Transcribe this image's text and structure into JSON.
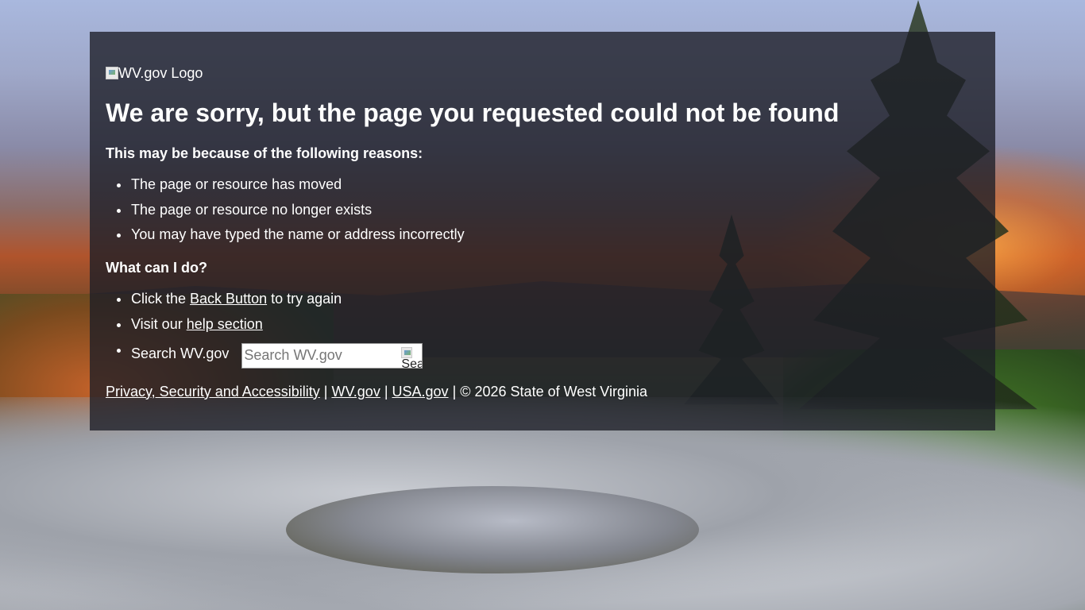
{
  "logo": {
    "alt": "WV.gov Logo"
  },
  "heading": "We are sorry, but the page you requested could not be found",
  "reasons": {
    "title": "This may be because of the following reasons:",
    "items": [
      "The page or resource has moved",
      "The page or resource no longer exists",
      "You may have typed the name or address incorrectly"
    ]
  },
  "actions": {
    "title": "What can I do?",
    "back": {
      "prefix": "Click the ",
      "link": "Back Button",
      "suffix": " to try again"
    },
    "help": {
      "prefix": "Visit our ",
      "link": "help section"
    },
    "search": {
      "label": "Search WV.gov",
      "placeholder": "Search WV.gov",
      "button_alt": "Search"
    }
  },
  "footer": {
    "privacy": "Privacy, Security and Accessibility",
    "sep1": " | ",
    "wvgov": "WV.gov",
    "sep2": " | ",
    "usagov": "USA.gov",
    "copyright": " | © 2026 State of West Virginia"
  },
  "colors": {
    "panel_bg": "#1c1e26",
    "text": "#ffffff"
  }
}
